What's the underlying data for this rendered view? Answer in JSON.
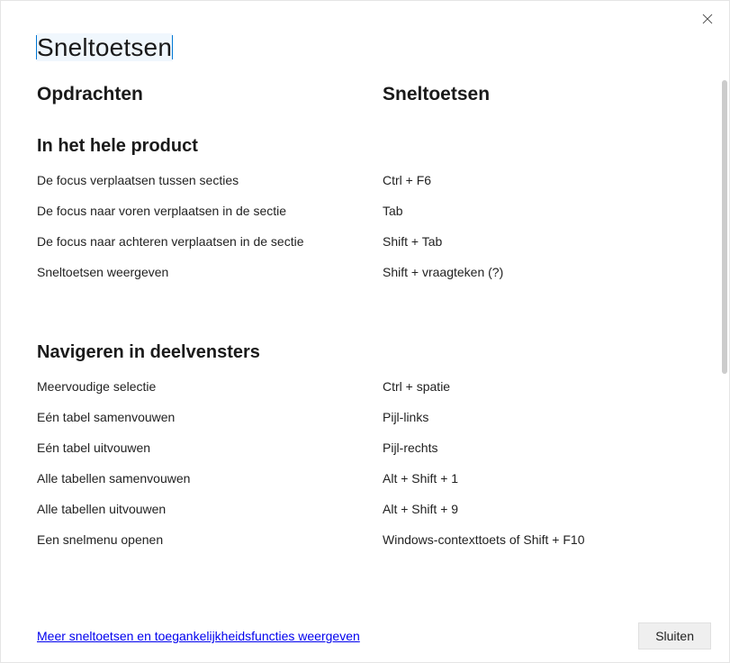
{
  "dialog": {
    "title": "Sneltoetsen",
    "columns": {
      "commands": "Opdrachten",
      "shortcuts": "Sneltoetsen"
    },
    "sections": [
      {
        "heading": "In het hele product",
        "rows": [
          {
            "command": "De focus verplaatsen tussen secties",
            "shortcut": "Ctrl + F6"
          },
          {
            "command": "De focus naar voren verplaatsen in de sectie",
            "shortcut": "Tab"
          },
          {
            "command": "De focus naar achteren verplaatsen in de sectie",
            "shortcut": "Shift + Tab"
          },
          {
            "command": "Sneltoetsen weergeven",
            "shortcut": "Shift + vraagteken (?)"
          }
        ]
      },
      {
        "heading": "Navigeren in deelvensters",
        "rows": [
          {
            "command": "Meervoudige selectie",
            "shortcut": "Ctrl + spatie"
          },
          {
            "command": "Eén tabel samenvouwen",
            "shortcut": "Pijl-links"
          },
          {
            "command": "Eén tabel uitvouwen",
            "shortcut": "Pijl-rechts"
          },
          {
            "command": "Alle tabellen samenvouwen",
            "shortcut": "Alt + Shift + 1"
          },
          {
            "command": "Alle tabellen uitvouwen",
            "shortcut": "Alt + Shift + 9"
          },
          {
            "command": "Een snelmenu openen",
            "shortcut": "Windows-contexttoets of Shift + F10"
          }
        ]
      }
    ],
    "footer": {
      "more_link": "Meer sneltoetsen en toegankelijkheidsfuncties weergeven",
      "close_button": "Sluiten"
    }
  }
}
